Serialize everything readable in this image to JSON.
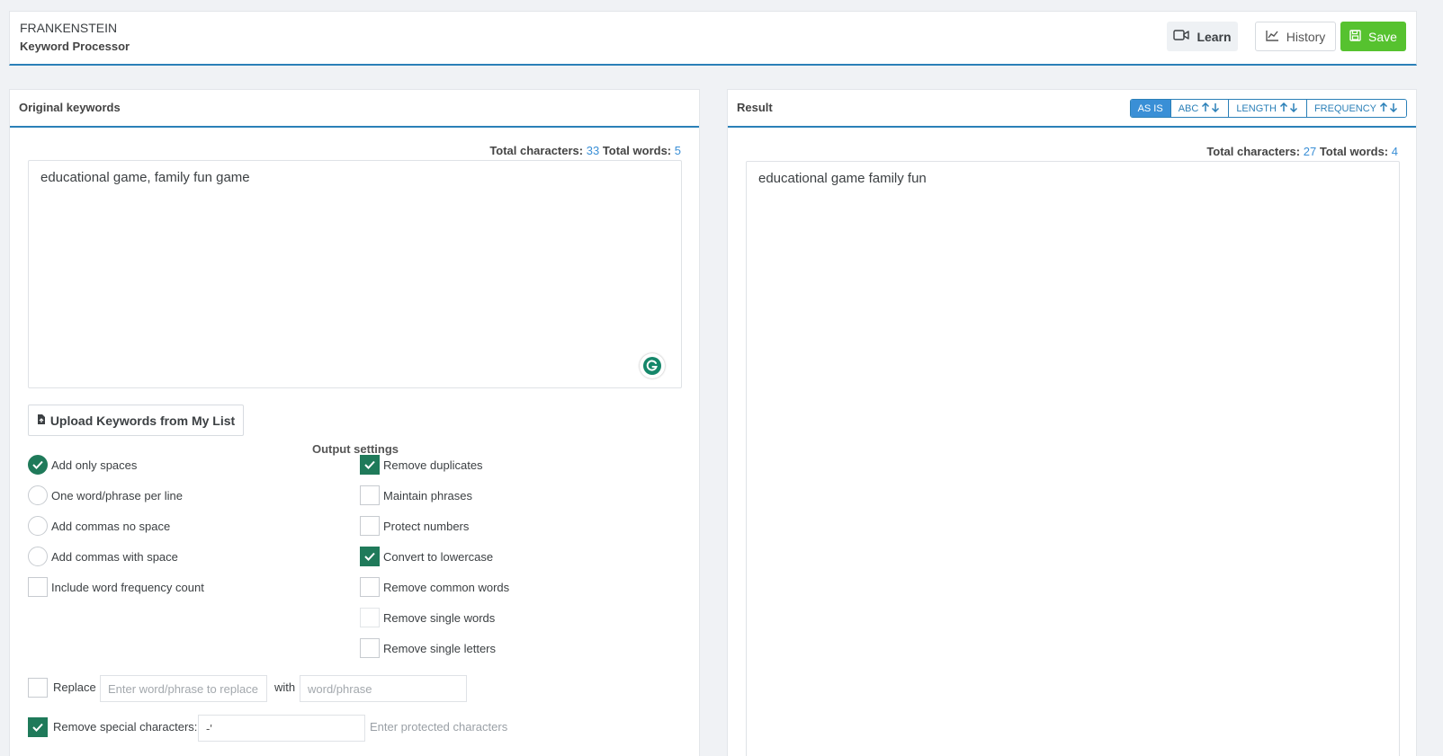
{
  "header": {
    "title": "FRANKENSTEIN",
    "subtitle": "Keyword Processor",
    "learn_label": "Learn",
    "history_label": "History",
    "save_label": "Save"
  },
  "left": {
    "title": "Original keywords",
    "counts": {
      "chars_label": "Total characters:",
      "chars": "33",
      "words_label": "Total words:",
      "words": "5"
    },
    "text": "educational game, family fun game",
    "upload_label": "Upload Keywords from My List",
    "output_title": "Output settings",
    "radios": [
      {
        "label": "Add only spaces",
        "checked": true
      },
      {
        "label": "One word/phrase per line",
        "checked": false
      },
      {
        "label": "Add commas no space",
        "checked": false
      },
      {
        "label": "Add commas with space",
        "checked": false
      }
    ],
    "freq_label": "Include word frequency count",
    "checks": [
      {
        "label": "Remove duplicates",
        "checked": true
      },
      {
        "label": "Maintain phrases",
        "checked": false
      },
      {
        "label": "Protect numbers",
        "checked": false
      },
      {
        "label": "Convert to lowercase",
        "checked": true
      },
      {
        "label": "Remove common words",
        "checked": false
      },
      {
        "label": "Remove single words",
        "checked": false
      },
      {
        "label": "Remove single letters",
        "checked": false
      }
    ],
    "replace": {
      "label": "Replace",
      "find_placeholder": "Enter word/phrase to replace",
      "with_label": "with",
      "with_placeholder": "word/phrase"
    },
    "special": {
      "label": "Remove special characters:",
      "value": "-'",
      "hint": "Enter protected characters"
    }
  },
  "right": {
    "title": "Result",
    "sort": [
      "AS IS",
      "ABC",
      "LENGTH",
      "FREQUENCY"
    ],
    "counts": {
      "chars_label": "Total characters:",
      "chars": "27",
      "words_label": "Total words:",
      "words": "4"
    },
    "text": "educational game family fun"
  },
  "colors": {
    "accent": "#2b80b8",
    "check": "#1f7a5a",
    "save": "#56c22f"
  }
}
